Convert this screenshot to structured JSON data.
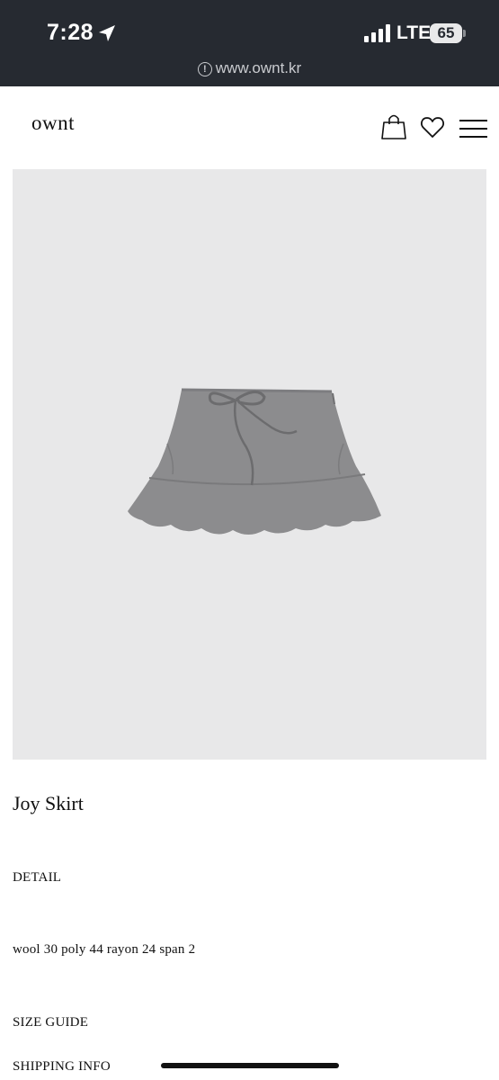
{
  "status_bar": {
    "time": "7:28",
    "network": "LTE",
    "battery": "65"
  },
  "browser": {
    "url": "www.ownt.kr"
  },
  "header": {
    "logo": "ownt"
  },
  "product": {
    "name": "Joy Skirt",
    "detail_label": "DETAIL",
    "material": "wool 30 poly 44 rayon 24 span 2",
    "size_guide_label": "SIZE GUIDE",
    "shipping_info_label": "SHIPPING INFO"
  },
  "colors": {
    "status_bar_bg": "#262a31",
    "image_bg": "#e8e8e9",
    "skirt": "#8c8c8e"
  },
  "icons": [
    "location-arrow-icon",
    "signal-icon",
    "info-icon",
    "shopping-bag-icon",
    "heart-icon",
    "hamburger-menu-icon"
  ]
}
